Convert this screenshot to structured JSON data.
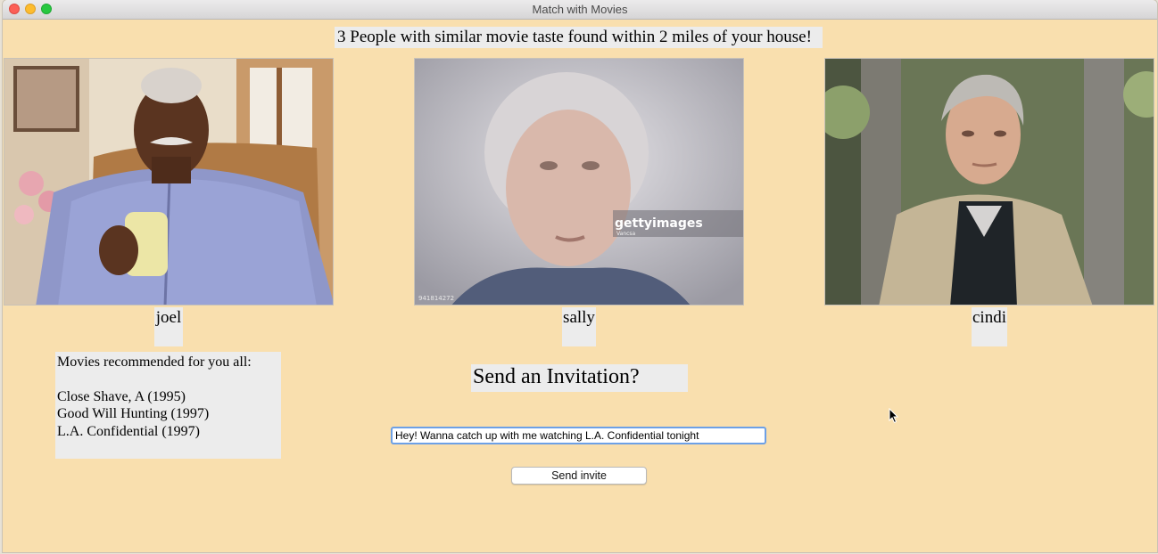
{
  "window": {
    "title": "Match with Movies"
  },
  "headline": "3 People with similar movie taste found within 2 miles of your house!",
  "matches": [
    {
      "name": "joel"
    },
    {
      "name": "sally",
      "watermark": "gettyimages",
      "watermark_sub": "Vancsa",
      "photo_id": "941814272"
    },
    {
      "name": "cindi"
    }
  ],
  "recommendations": {
    "heading": "Movies recommended for you all:",
    "movies": [
      "Close Shave, A (1995)",
      "Good Will Hunting (1997)",
      "L.A. Confidential (1997)"
    ]
  },
  "invitation": {
    "heading": "Send an Invitation?",
    "message_value": "Hey! Wanna catch up with me watching L.A. Confidential tonight",
    "send_label": "Send invite"
  },
  "colors": {
    "background": "#f9dfae",
    "label_background": "#ececec",
    "focus_ring": "#6da0e6"
  }
}
